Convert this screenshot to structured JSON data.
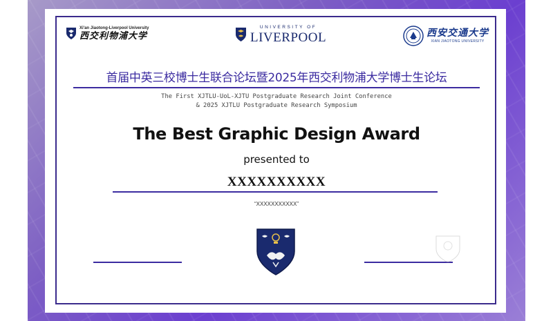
{
  "logos": {
    "xjtlu_en": "Xi'an Jiaotong-Liverpool University",
    "xjtlu_cn": "西交利物浦大学",
    "uol_top": "UNIVERSITY OF",
    "uol_main": "LIVERPOOL",
    "xjtu_cn": "西安交通大学",
    "xjtu_en": "XIAN JIAOTONG UNIVERSITY"
  },
  "certificate": {
    "title_cn": "首届中英三校博士生联合论坛暨2025年西交利物浦大学博士生论坛",
    "subtitle_line1": "The First XJTLU-UoL-XJTU Postgraduate Research Joint Conference",
    "subtitle_line2": "& 2025 XJTLU Postgraduate Research Symposium",
    "award": "The Best Graphic Design Award",
    "presented_to": "presented to",
    "recipient": "XXXXXXXXXX",
    "work_title": "“XXXXXXXXXXX”"
  },
  "colors": {
    "accent": "#3b2ba0",
    "frame": "#7d5fc4",
    "crest": "#1a2a6e"
  }
}
